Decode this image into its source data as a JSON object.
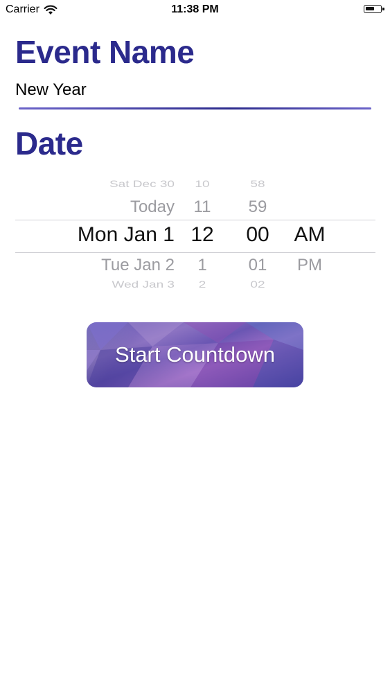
{
  "status_bar": {
    "carrier": "Carrier",
    "time": "11:38 PM",
    "signal_icon": "wifi-icon",
    "battery_icon": "battery-icon"
  },
  "event": {
    "title": "Event Name",
    "name_value": "New Year"
  },
  "date": {
    "title": "Date"
  },
  "picker": {
    "rows": [
      {
        "date": "Sat Dec 30",
        "hour": "10",
        "minute": "58",
        "ampm": ""
      },
      {
        "date": "Today",
        "hour": "11",
        "minute": "59",
        "ampm": ""
      },
      {
        "date": "Mon Jan 1",
        "hour": "12",
        "minute": "00",
        "ampm": "AM"
      },
      {
        "date": "Tue Jan 2",
        "hour": "1",
        "minute": "01",
        "ampm": "PM"
      },
      {
        "date": "Wed Jan 3",
        "hour": "2",
        "minute": "02",
        "ampm": ""
      }
    ]
  },
  "actions": {
    "start_label": "Start Countdown"
  },
  "colors": {
    "title": "#2b2a8c",
    "underline": "#3b3aa0",
    "button_gradient": [
      "#5a4fb0",
      "#9b6dc6",
      "#4e3e9e"
    ]
  }
}
